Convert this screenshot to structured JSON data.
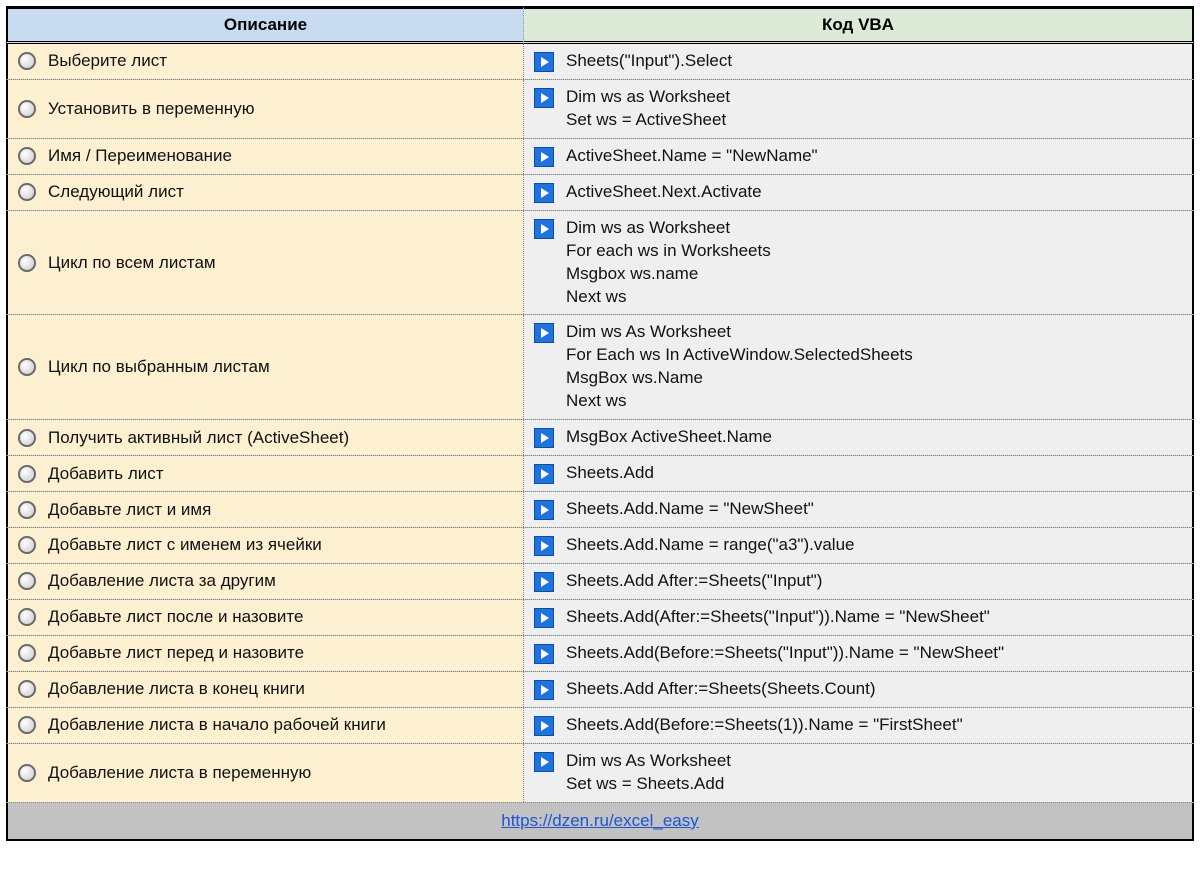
{
  "headers": {
    "description": "Описание",
    "code": "Код VBA"
  },
  "rows": [
    {
      "desc": "Выберите лист",
      "code": "Sheets(\"Input\").Select"
    },
    {
      "desc": "Установить в переменную",
      "code": "Dim ws as Worksheet\nSet ws = ActiveSheet"
    },
    {
      "desc": "Имя / Переименование",
      "code": "ActiveSheet.Name = \"NewName\""
    },
    {
      "desc": "Следующий лист",
      "code": "ActiveSheet.Next.Activate"
    },
    {
      "desc": "Цикл по всем листам",
      "code": "Dim ws as Worksheet\nFor each ws in Worksheets\nMsgbox ws.name\nNext ws"
    },
    {
      "desc": "Цикл по выбранным листам",
      "code": "Dim ws As Worksheet\nFor Each ws In ActiveWindow.SelectedSheets\nMsgBox ws.Name\nNext ws"
    },
    {
      "desc": "Получить активный лист (ActiveSheet)",
      "code": "MsgBox ActiveSheet.Name"
    },
    {
      "desc": "Добавить лист",
      "code": "Sheets.Add"
    },
    {
      "desc": "Добавьте лист и имя",
      "code": "Sheets.Add.Name = \"NewSheet\""
    },
    {
      "desc": "Добавьте лист с именем из ячейки",
      "code": "Sheets.Add.Name = range(\"a3\").value"
    },
    {
      "desc": "Добавление листа за другим",
      "code": "Sheets.Add After:=Sheets(\"Input\")"
    },
    {
      "desc": "Добавьте лист после и назовите",
      "code": "Sheets.Add(After:=Sheets(\"Input\")).Name = \"NewSheet\""
    },
    {
      "desc": "Добавьте лист перед и назовите",
      "code": "Sheets.Add(Before:=Sheets(\"Input\")).Name = \"NewSheet\""
    },
    {
      "desc": "Добавление листа в конец книги",
      "code": "Sheets.Add After:=Sheets(Sheets.Count)"
    },
    {
      "desc": "Добавление листа в начало рабочей книги",
      "code": "Sheets.Add(Before:=Sheets(1)).Name = \"FirstSheet\""
    },
    {
      "desc": "Добавление листа в переменную",
      "code": "Dim ws As Worksheet\nSet ws = Sheets.Add"
    }
  ],
  "footer": {
    "link_text": "https://dzen.ru/excel_easy"
  }
}
